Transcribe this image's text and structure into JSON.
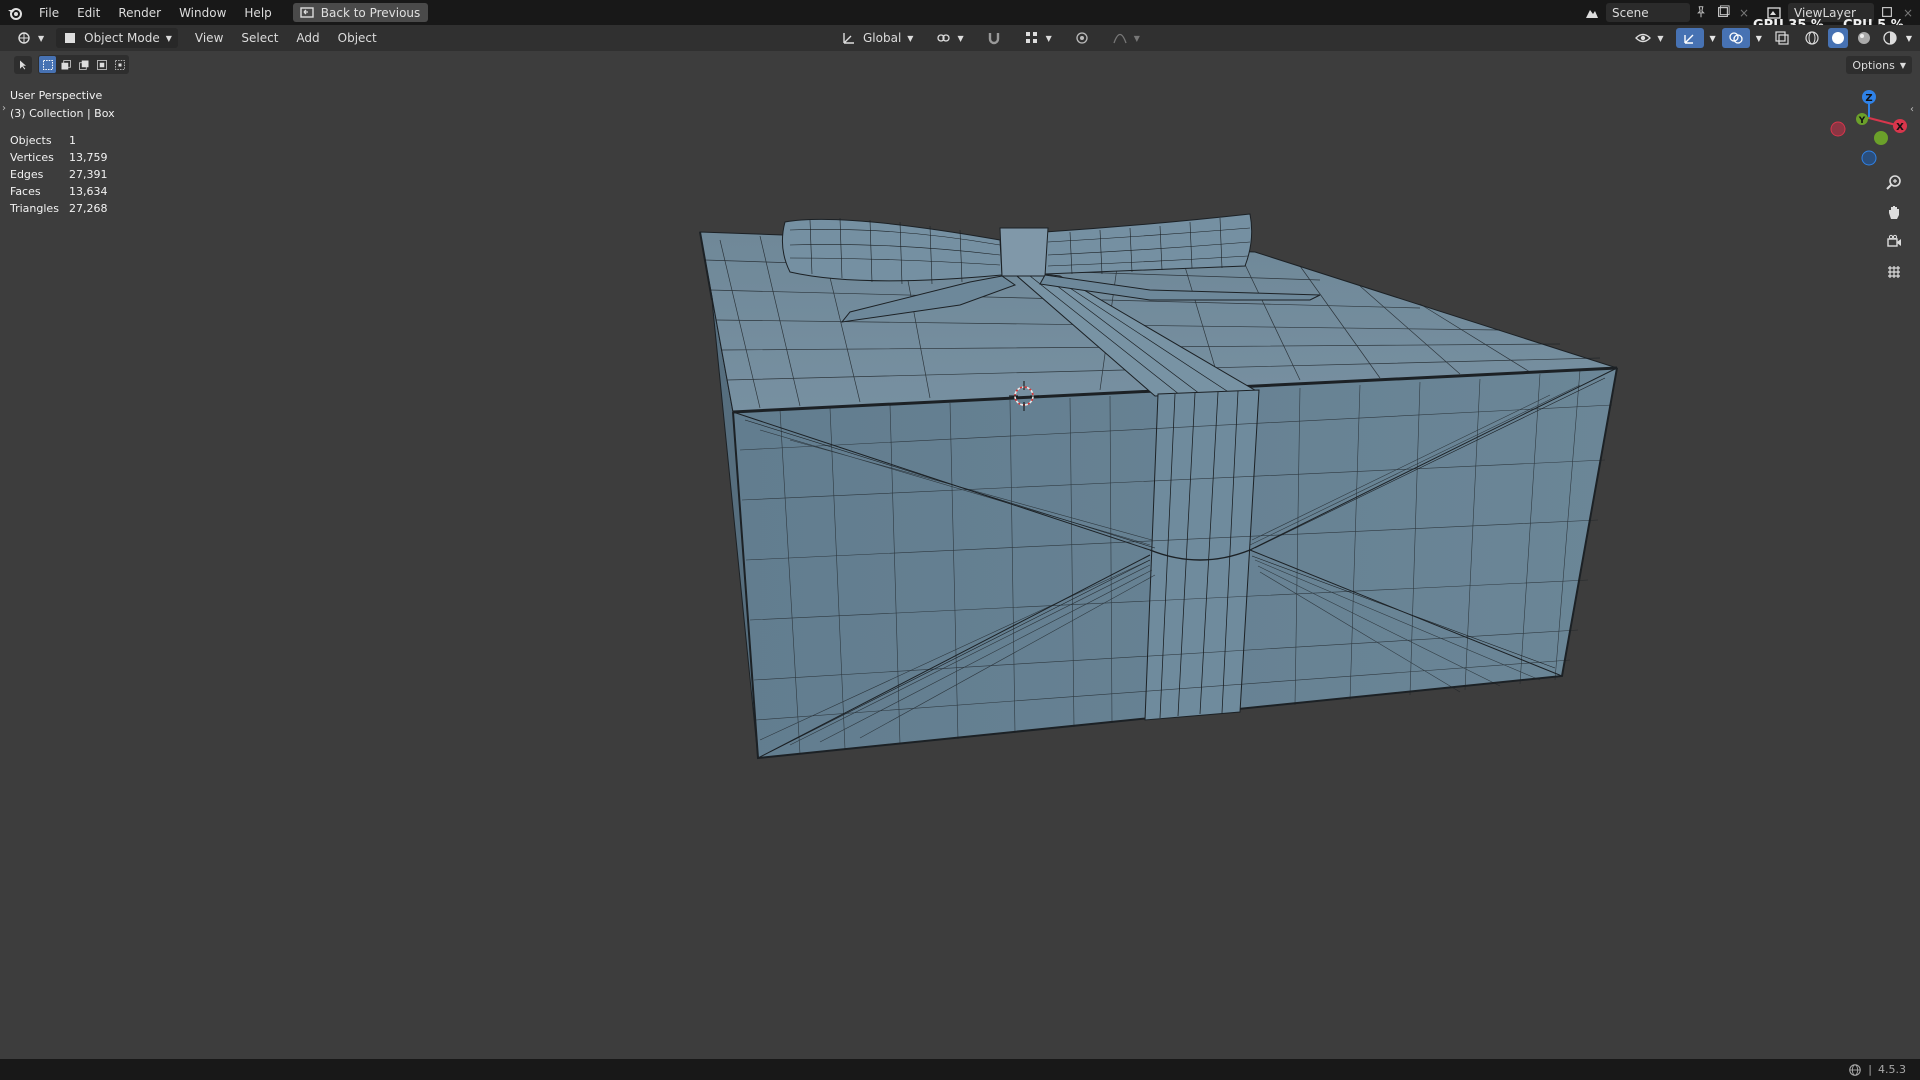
{
  "topbar": {
    "menu": [
      "File",
      "Edit",
      "Render",
      "Window",
      "Help"
    ],
    "back_button": "Back to Previous",
    "scene": "Scene",
    "view_layer": "ViewLayer",
    "gpu": "GPU 35 %",
    "cpu": "CPU 5 %"
  },
  "header": {
    "mode": "Object Mode",
    "menu": [
      "View",
      "Select",
      "Add",
      "Object"
    ],
    "transform_orientation": "Global",
    "options": "Options"
  },
  "viewport": {
    "perspective": "User Perspective",
    "collection": "(3) Collection | Box",
    "stats": [
      {
        "label": "Objects",
        "value": "1"
      },
      {
        "label": "Vertices",
        "value": "13,759"
      },
      {
        "label": "Edges",
        "value": "27,391"
      },
      {
        "label": "Faces",
        "value": "13,634"
      },
      {
        "label": "Triangles",
        "value": "27,268"
      }
    ],
    "gizmo_axes": {
      "x": "X",
      "y": "Y",
      "z": "Z"
    }
  },
  "status": {
    "version": "4.5.3"
  },
  "colors": {
    "viewport_bg": "#3d3d3d",
    "mesh_fill": "#6d8799",
    "wire": "#1d2226",
    "accent": "#4772b3"
  }
}
